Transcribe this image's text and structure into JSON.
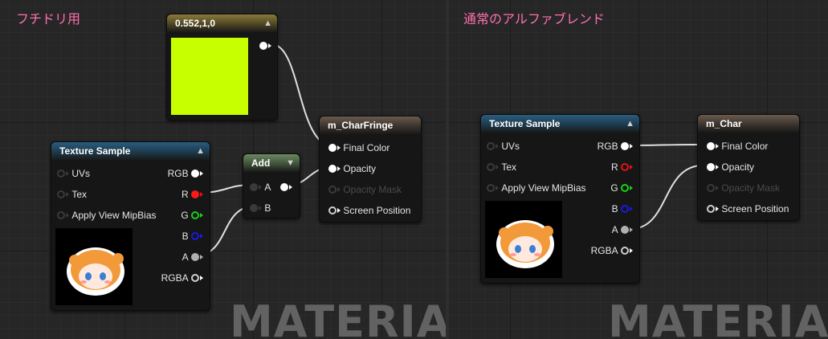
{
  "colors": {
    "swatch": "#c8ff00",
    "title_pink": "#ff6fb0",
    "wire": "#e0e0e0"
  },
  "left": {
    "title": "フチドリ用",
    "watermark": "MATERIAL",
    "constant": {
      "label": "0.552,1,0"
    },
    "texture": {
      "title": "Texture Sample",
      "inputs": [
        "UVs",
        "Tex",
        "Apply View MipBias"
      ],
      "outputs": [
        "RGB",
        "R",
        "G",
        "B",
        "A",
        "RGBA"
      ]
    },
    "add": {
      "title": "Add",
      "inputs": [
        "A",
        "B"
      ]
    },
    "material": {
      "title": "m_CharFringe",
      "inputs": [
        "Final Color",
        "Opacity",
        "Opacity Mask",
        "Screen Position"
      ]
    }
  },
  "right": {
    "title": "通常のアルファブレンド",
    "watermark": "MATERIAL",
    "texture": {
      "title": "Texture Sample",
      "inputs": [
        "UVs",
        "Tex",
        "Apply View MipBias"
      ],
      "outputs": [
        "RGB",
        "R",
        "G",
        "B",
        "A",
        "RGBA"
      ]
    },
    "material": {
      "title": "m_Char",
      "inputs": [
        "Final Color",
        "Opacity",
        "Opacity Mask",
        "Screen Position"
      ]
    }
  }
}
